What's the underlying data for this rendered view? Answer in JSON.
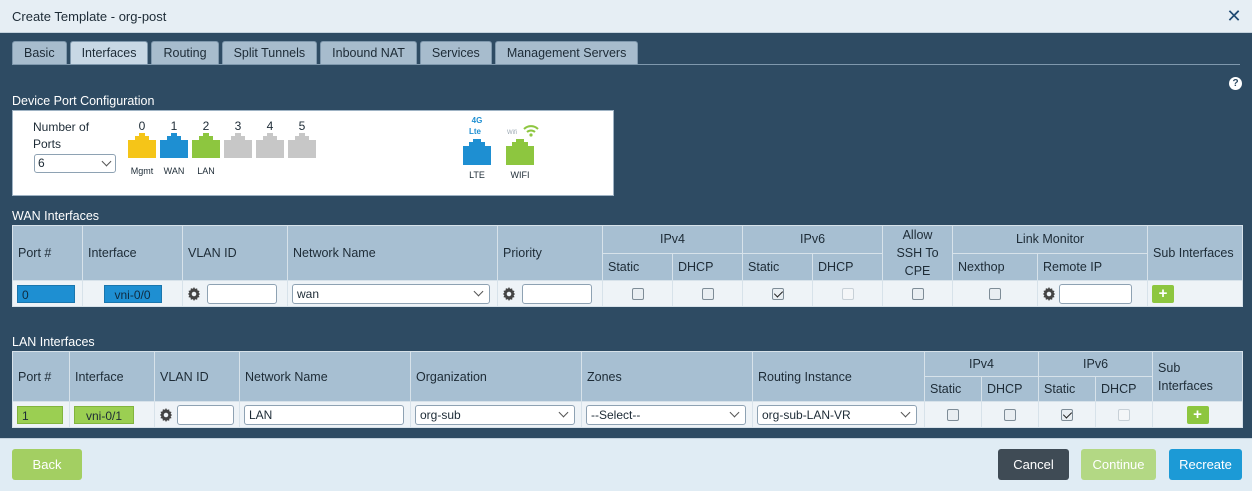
{
  "dialog": {
    "title": "Create Template - org-post",
    "close_glyph": "✕"
  },
  "tabs": [
    {
      "label": "Basic",
      "active": false
    },
    {
      "label": "Interfaces",
      "active": true
    },
    {
      "label": "Routing",
      "active": false
    },
    {
      "label": "Split Tunnels",
      "active": false
    },
    {
      "label": "Inbound NAT",
      "active": false
    },
    {
      "label": "Services",
      "active": false
    },
    {
      "label": "Management Servers",
      "active": false
    }
  ],
  "help_glyph": "?",
  "device_port": {
    "section_title": "Device Port Configuration",
    "number_of_ports_label": "Number of Ports",
    "number_of_ports_value": "6",
    "ports": [
      {
        "num": "0",
        "label": "Mgmt",
        "color": "#f5c518"
      },
      {
        "num": "1",
        "label": "WAN",
        "color": "#1e8fd2"
      },
      {
        "num": "2",
        "label": "LAN",
        "color": "#8dc63f"
      },
      {
        "num": "3",
        "label": "",
        "color": "#c7c7c7"
      },
      {
        "num": "4",
        "label": "",
        "color": "#c7c7c7"
      },
      {
        "num": "5",
        "label": "",
        "color": "#c7c7c7"
      }
    ],
    "lte": {
      "label": "LTE",
      "badge_top": "4G",
      "badge_bottom": "Lte",
      "color": "#1e8fd2"
    },
    "wifi": {
      "label": "WIFI",
      "badge": "Wifi",
      "color": "#8dc63f"
    }
  },
  "wan": {
    "section_title": "WAN Interfaces",
    "headers": {
      "port": "Port #",
      "interface": "Interface",
      "vlan": "VLAN ID",
      "network": "Network Name",
      "priority": "Priority",
      "ipv4": "IPv4",
      "ipv6": "IPv6",
      "allow_ssh": "Allow SSH To CPE",
      "link_monitor": "Link Monitor",
      "sub_interfaces": "Sub Interfaces",
      "static": "Static",
      "dhcp": "DHCP",
      "nexthop": "Nexthop",
      "remote_ip": "Remote IP"
    },
    "row": {
      "port": "0",
      "interface": "vni-0/0",
      "vlan": "",
      "network": "wan",
      "priority": "",
      "ipv4_static": false,
      "ipv4_dhcp": false,
      "ipv6_static": true,
      "ipv6_dhcp": false,
      "allow_ssh": false,
      "nexthop": false,
      "remote_ip": "",
      "add": "+"
    }
  },
  "lan": {
    "section_title": "LAN Interfaces",
    "headers": {
      "port": "Port #",
      "interface": "Interface",
      "vlan": "VLAN ID",
      "network": "Network Name",
      "organization": "Organization",
      "zones": "Zones",
      "routing_instance": "Routing Instance",
      "ipv4": "IPv4",
      "ipv6": "IPv6",
      "sub_interfaces": "Sub Interfaces",
      "static": "Static",
      "dhcp": "DHCP"
    },
    "row": {
      "port": "1",
      "interface": "vni-0/1",
      "vlan": "",
      "network": "LAN",
      "organization": "org-sub",
      "zones": "--Select--",
      "routing_instance": "org-sub-LAN-VR",
      "ipv4_static": false,
      "ipv4_dhcp": false,
      "ipv6_static": true,
      "ipv6_dhcp": false,
      "add": "+"
    }
  },
  "footer": {
    "back": "Back",
    "cancel": "Cancel",
    "continue": "Continue",
    "recreate": "Recreate"
  }
}
